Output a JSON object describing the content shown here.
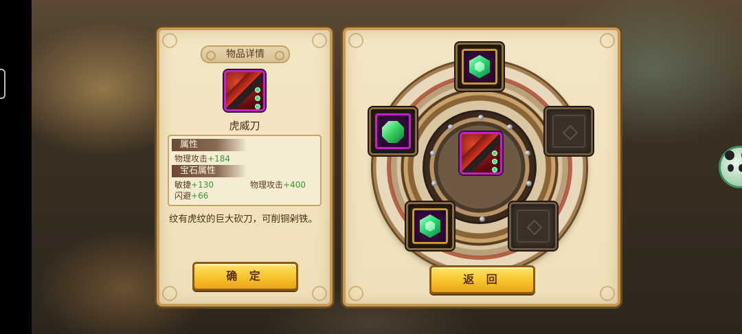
{
  "item_detail": {
    "title": "物品详情",
    "item_name": "虎威刀",
    "attributes_header": "属性",
    "base_stats": [
      {
        "label": "物理攻击",
        "value": "+184"
      }
    ],
    "gem_attributes_header": "宝石属性",
    "gem_stats": [
      {
        "label": "敏捷",
        "value": "+130"
      },
      {
        "label": "物理攻击",
        "value": "+400"
      },
      {
        "label": "闪避",
        "value": "+66"
      }
    ],
    "description": "纹有虎纹的巨大砍刀，可削铜剁铁。",
    "confirm_label": "确 定"
  },
  "gem_socket": {
    "center_item_icon": "tiger-blade-icon",
    "slots": [
      {
        "position": "top",
        "state": "filled",
        "gem": "green-gem-icon"
      },
      {
        "position": "left",
        "state": "filled",
        "gem": "green-gem-icon"
      },
      {
        "position": "right",
        "state": "empty"
      },
      {
        "position": "bottom-left",
        "state": "filled",
        "gem": "green-gem-icon"
      },
      {
        "position": "bottom-right",
        "state": "empty"
      }
    ],
    "back_label": "返 回"
  },
  "colors": {
    "panel_bg": "#f3e6c4",
    "panel_border": "#c69a55",
    "stat_value_green": "#2f9a2f",
    "rarity_purple": "#c222c8",
    "button_yellow": "#f7c42b"
  }
}
